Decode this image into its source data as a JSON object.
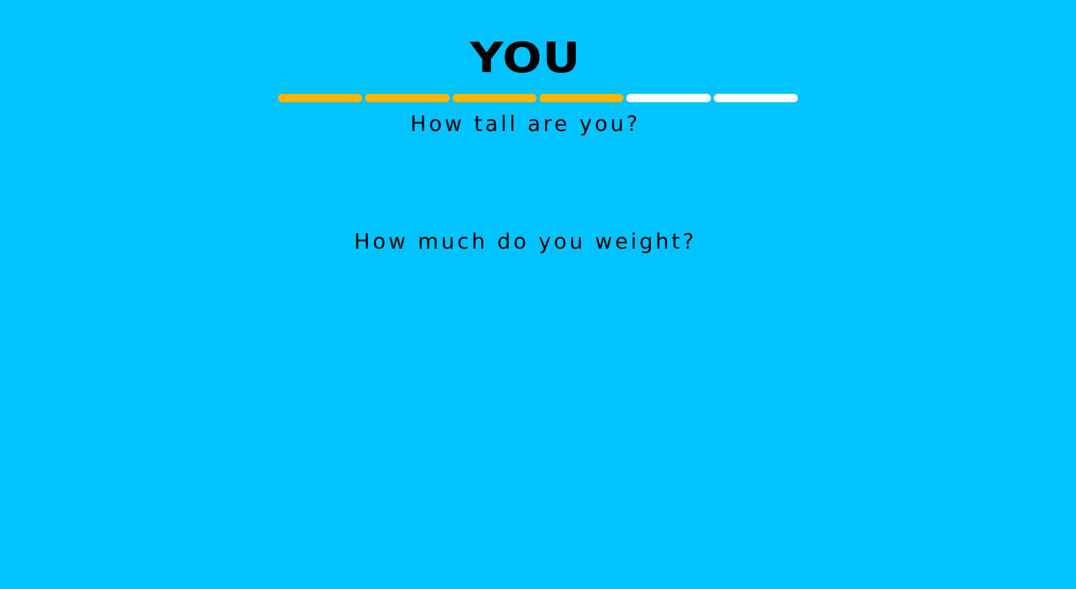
{
  "page": {
    "title": "YOU",
    "background_color": "#00c3ff"
  },
  "progress": {
    "total_steps": 6,
    "completed_steps": 4,
    "filled_color": "#ffb400",
    "empty_color": "#ffffff"
  },
  "questions": [
    {
      "label": "How tall are you?"
    },
    {
      "label": "How much do you weight?"
    }
  ]
}
